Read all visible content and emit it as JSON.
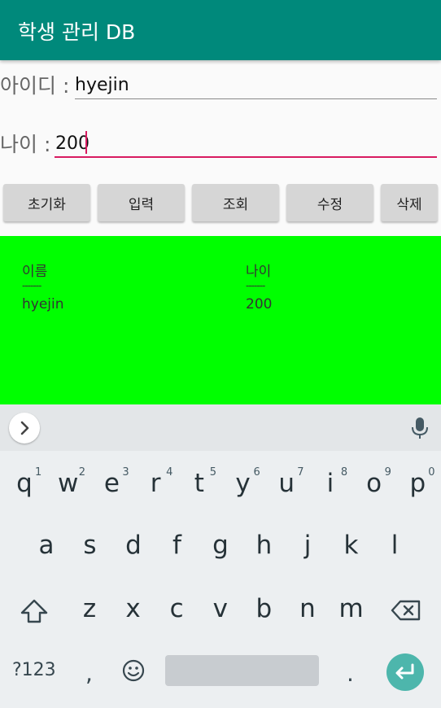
{
  "app": {
    "title": "학생 관리 DB",
    "accent": "#00897b"
  },
  "form": {
    "id_label": "아이디 :",
    "id_value": "hyejin",
    "age_label": "나이 :",
    "age_value": "200",
    "focus_color": "#d81b60"
  },
  "buttons": {
    "init": "초기화",
    "insert": "입력",
    "select": "조회",
    "update": "수정",
    "delete": "삭제"
  },
  "result": {
    "background": "#00ff00",
    "col_name_header": "이름",
    "col_age_header": "나이",
    "col_name_sep": "-------",
    "col_age_sep": "-------",
    "rows": [
      {
        "name": "hyejin",
        "age": "200"
      }
    ]
  },
  "keyboard": {
    "row1": [
      "q",
      "w",
      "e",
      "r",
      "t",
      "y",
      "u",
      "i",
      "o",
      "p"
    ],
    "row1_hints": [
      "1",
      "2",
      "3",
      "4",
      "5",
      "6",
      "7",
      "8",
      "9",
      "0"
    ],
    "row2": [
      "a",
      "s",
      "d",
      "f",
      "g",
      "h",
      "j",
      "k",
      "l"
    ],
    "row3": [
      "z",
      "x",
      "c",
      "v",
      "b",
      "n",
      "m"
    ],
    "symbols_key": "?123",
    "comma": ",",
    "period": ".",
    "icons": [
      "chevron-right-icon",
      "microphone-icon",
      "shift-icon",
      "backspace-icon",
      "emoji-icon",
      "enter-icon"
    ]
  }
}
